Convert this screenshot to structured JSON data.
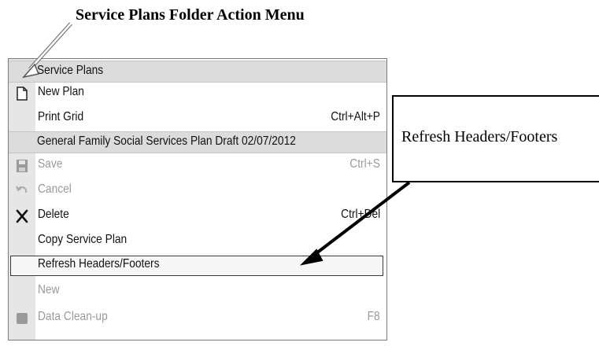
{
  "title": "Service Plans Folder Action Menu",
  "callout": {
    "text": "Refresh Headers/Footers"
  },
  "menu": {
    "section1_header": "Service Plans",
    "new_plan": {
      "label": "New Plan",
      "icon": "new-document-icon"
    },
    "print_grid": {
      "label": "Print Grid",
      "shortcut": "Ctrl+Alt+P"
    },
    "section2_header": "General Family Social Services Plan Draft 02/07/2012",
    "save": {
      "label": "Save",
      "shortcut": "Ctrl+S",
      "icon": "save-icon",
      "enabled": false
    },
    "cancel": {
      "label": "Cancel",
      "icon": "undo-icon",
      "enabled": false
    },
    "delete": {
      "label": "Delete",
      "shortcut": "Ctrl+Del",
      "icon": "delete-x-icon"
    },
    "copy_plan": {
      "label": "Copy Service Plan"
    },
    "refresh": {
      "label": "Refresh Headers/Footers",
      "highlighted": true
    },
    "new": {
      "label": "New",
      "enabled": false
    },
    "data_cleanup": {
      "label": "Data Clean-up",
      "shortcut": "F8",
      "icon": "data-cleanup-icon",
      "enabled": false
    }
  },
  "colors": {
    "menu_border": "#7a7a7a",
    "gutter": "#e6e6e6",
    "header_bg": "#dcdcdc",
    "disabled_text": "#9a9a9a"
  }
}
